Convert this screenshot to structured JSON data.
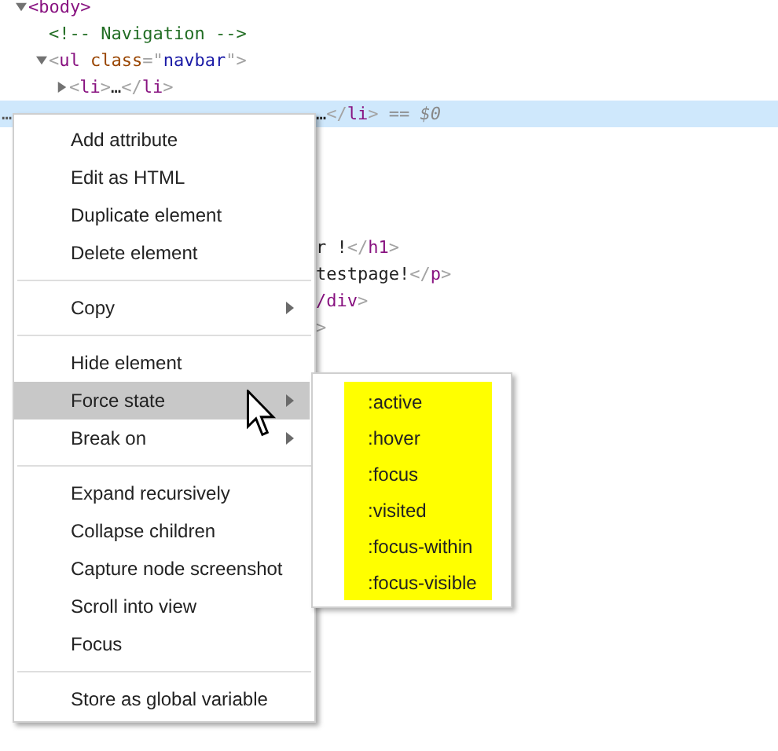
{
  "dom_tree": [
    {
      "kind": "element",
      "expanded": true,
      "segments": [
        {
          "kind": "tag",
          "text": "<body>"
        }
      ],
      "children": [
        {
          "kind": "comment",
          "segments": [
            {
              "kind": "comment",
              "text": "<!-- Navigation -->"
            }
          ]
        },
        {
          "kind": "element",
          "expanded": true,
          "segments": [
            {
              "kind": "bracket",
              "text": "<"
            },
            {
              "kind": "tag",
              "text": "ul "
            },
            {
              "kind": "attr",
              "text": "class"
            },
            {
              "kind": "bracket",
              "text": "=\""
            },
            {
              "kind": "value",
              "text": "navbar"
            },
            {
              "kind": "bracket",
              "text": "\">"
            }
          ],
          "children": [
            {
              "kind": "element",
              "expanded": false,
              "segments": [
                {
                  "kind": "bracket",
                  "text": "<"
                },
                {
                  "kind": "tag",
                  "text": "li"
                },
                {
                  "kind": "bracket",
                  "text": ">"
                },
                {
                  "kind": "text",
                  "text": "…"
                },
                {
                  "kind": "bracket",
                  "text": "</"
                },
                {
                  "kind": "tag",
                  "text": "li"
                },
                {
                  "kind": "bracket",
                  "text": ">"
                }
              ]
            }
          ]
        }
      ]
    }
  ],
  "selected_row": {
    "selected": true,
    "dots": "…",
    "segments": [
      {
        "kind": "text",
        "text": "…"
      },
      {
        "kind": "bracket",
        "text": "</"
      },
      {
        "kind": "tag",
        "text": "li"
      },
      {
        "kind": "bracket",
        "text": ">"
      },
      {
        "kind": "marker",
        "text": " == $0"
      }
    ]
  },
  "partly_hidden_lines": [
    {
      "segments": [
        {
          "kind": "text",
          "text": "r !"
        },
        {
          "kind": "bracket",
          "text": "</"
        },
        {
          "kind": "tag",
          "text": "h1"
        },
        {
          "kind": "bracket",
          "text": ">"
        }
      ]
    },
    {
      "segments": [
        {
          "kind": "text",
          "text": " testpage!"
        },
        {
          "kind": "bracket",
          "text": "</"
        },
        {
          "kind": "tag",
          "text": "p"
        },
        {
          "kind": "bracket",
          "text": ">"
        }
      ]
    },
    {
      "segments": [
        {
          "kind": "tag",
          "text": "/div"
        },
        {
          "kind": "bracket",
          "text": ">"
        }
      ]
    },
    {
      "segments": [
        {
          "kind": "bracket",
          "text": ">"
        }
      ]
    }
  ],
  "context_menu": [
    {
      "kind": "item",
      "label": "Add attribute",
      "submenu": false,
      "selected": false
    },
    {
      "kind": "item",
      "label": "Edit as HTML",
      "submenu": false,
      "selected": false
    },
    {
      "kind": "item",
      "label": "Duplicate element",
      "submenu": false,
      "selected": false
    },
    {
      "kind": "item",
      "label": "Delete element",
      "submenu": false,
      "selected": false
    },
    {
      "kind": "separator"
    },
    {
      "kind": "item",
      "label": "Copy",
      "submenu": true,
      "selected": false
    },
    {
      "kind": "separator"
    },
    {
      "kind": "item",
      "label": "Hide element",
      "submenu": false,
      "selected": false
    },
    {
      "kind": "item",
      "label": "Force state",
      "submenu": true,
      "selected": true
    },
    {
      "kind": "item",
      "label": "Break on",
      "submenu": true,
      "selected": false
    },
    {
      "kind": "separator"
    },
    {
      "kind": "item",
      "label": "Expand recursively",
      "submenu": false,
      "selected": false
    },
    {
      "kind": "item",
      "label": "Collapse children",
      "submenu": false,
      "selected": false
    },
    {
      "kind": "item",
      "label": "Capture node screenshot",
      "submenu": false,
      "selected": false
    },
    {
      "kind": "item",
      "label": "Scroll into view",
      "submenu": false,
      "selected": false
    },
    {
      "kind": "item",
      "label": "Focus",
      "submenu": false,
      "selected": false
    },
    {
      "kind": "separator"
    },
    {
      "kind": "item",
      "label": "Store as global variable",
      "submenu": false,
      "selected": false
    }
  ],
  "submenu": {
    "highlighted": true,
    "items": [
      {
        "label": ":active"
      },
      {
        "label": ":hover"
      },
      {
        "label": ":focus"
      },
      {
        "label": ":visited"
      },
      {
        "label": ":focus-within"
      },
      {
        "label": ":focus-visible"
      }
    ]
  }
}
